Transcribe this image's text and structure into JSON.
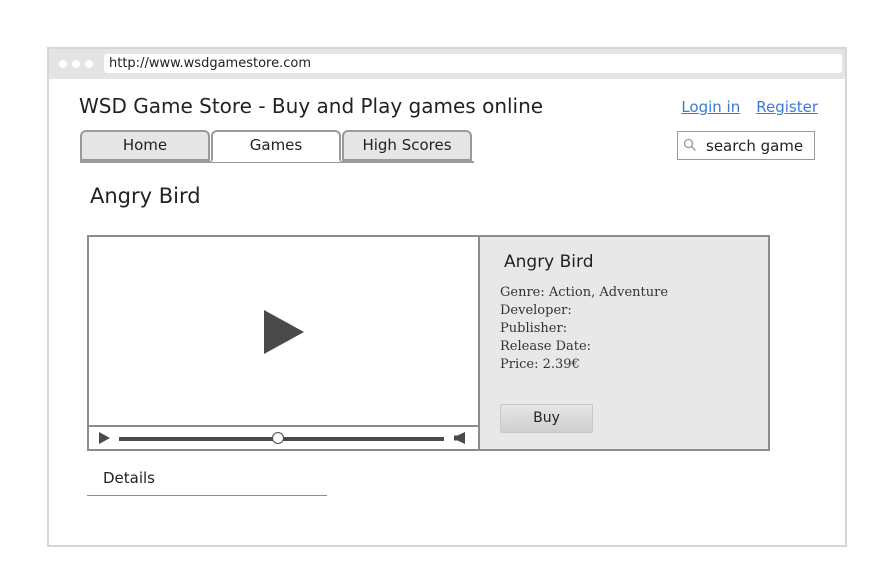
{
  "browser": {
    "url": "http://www.wsdgamestore.com"
  },
  "header": {
    "title": "WSD Game Store - Buy and Play games online",
    "login_label": "Login in",
    "register_label": "Register"
  },
  "nav": {
    "tabs": [
      {
        "label": "Home"
      },
      {
        "label": "Games",
        "active": true
      },
      {
        "label": "High Scores"
      }
    ]
  },
  "search": {
    "value": "search game",
    "icon": "search-icon"
  },
  "page": {
    "heading": "Angry Bird"
  },
  "video": {
    "progress": 0.49
  },
  "game": {
    "title": "Angry Bird",
    "genre": "Genre: Action, Adventure",
    "developer": "Developer:",
    "publisher": "Publisher:",
    "release_date": "Release Date:",
    "price": "Price: 2.39€",
    "buy_label": "Buy"
  },
  "details": {
    "label": "Details"
  }
}
